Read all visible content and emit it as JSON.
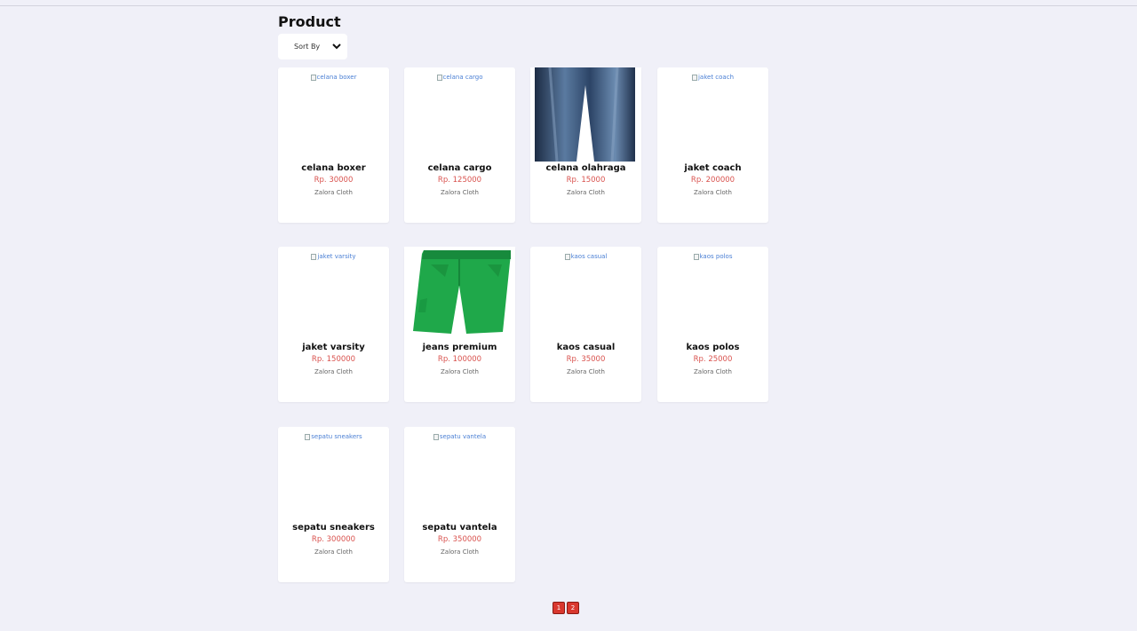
{
  "page": {
    "title": "Product",
    "sort_label": "Sort By"
  },
  "products": [
    {
      "name": "celana boxer",
      "price": "Rp. 30000",
      "brand": "Zalora Cloth",
      "image_alt": "celana boxer",
      "image": "broken"
    },
    {
      "name": "celana cargo",
      "price": "Rp. 125000",
      "brand": "Zalora Cloth",
      "image_alt": "celana cargo",
      "image": "broken"
    },
    {
      "name": "celana olahraga",
      "price": "Rp. 15000",
      "brand": "Zalora Cloth",
      "image_alt": "celana olahraga",
      "image": "jeans-photo"
    },
    {
      "name": "jaket coach",
      "price": "Rp. 200000",
      "brand": "Zalora Cloth",
      "image_alt": "jaket coach",
      "image": "broken"
    },
    {
      "name": "jaket varsity",
      "price": "Rp. 150000",
      "brand": "Zalora Cloth",
      "image_alt": "jaket varsity",
      "image": "broken"
    },
    {
      "name": "jeans premium",
      "price": "Rp. 100000",
      "brand": "Zalora Cloth",
      "image_alt": "jeans premium",
      "image": "green-shorts-photo"
    },
    {
      "name": "kaos casual",
      "price": "Rp. 35000",
      "brand": "Zalora Cloth",
      "image_alt": "kaos casual",
      "image": "broken"
    },
    {
      "name": "kaos polos",
      "price": "Rp. 25000",
      "brand": "Zalora Cloth",
      "image_alt": "kaos polos",
      "image": "broken"
    },
    {
      "name": "sepatu sneakers",
      "price": "Rp. 300000",
      "brand": "Zalora Cloth",
      "image_alt": "sepatu sneakers",
      "image": "broken"
    },
    {
      "name": "sepatu vantela",
      "price": "Rp. 350000",
      "brand": "Zalora Cloth",
      "image_alt": "sepatu vantela",
      "image": "broken"
    }
  ],
  "pagination": {
    "pages": [
      "1",
      "2"
    ]
  },
  "colors": {
    "background": "#f0f0f8",
    "price": "#d9534f",
    "pagination": "#d9382f",
    "alt_link": "#4a7fd4"
  }
}
